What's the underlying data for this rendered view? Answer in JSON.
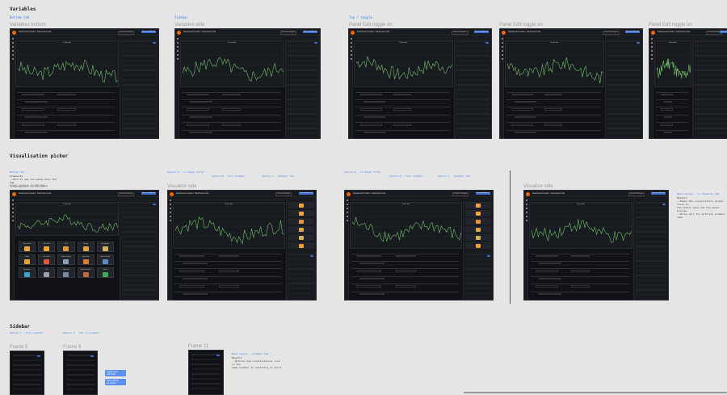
{
  "sections": {
    "variables": "Variables",
    "visualisation_picker": "Visualisation picker",
    "sidebar": "Sidebar"
  },
  "groups": {
    "bottom_tab": "Bottom tab",
    "sidebar": "Sidebar",
    "top_toggle": "Top / toggle"
  },
  "frames": {
    "variables_bottom": "Variables bottom",
    "variables_side": "Variables side",
    "panel_edit_toggle_1": "Panel Edit toggle on",
    "panel_edit_toggle_2": "Panel Edit toggle on",
    "panel_edit_toggle_3": "Panel Edit toggle on",
    "visualize_bottom": "Visualize bottom",
    "visualize_side_1": "Visualize side",
    "visualize_side_2": "Visualize side",
    "frame_5": "Frame 5",
    "frame_8": "Frame 8",
    "frame_11": "Frame 11"
  },
  "dashboard": {
    "breadcrumb": "Dashboard Folder / Dashboard title",
    "discard": "Discard changes",
    "save": "Save dashboard",
    "panel_title": "Panel title"
  },
  "notes": {
    "viz_note_title": "Bottom tab",
    "viz_note_body": "Drawbacks\n- Hard to see the panel when the tab\n  takes up most of the space",
    "option_a_title": "Option A - in Panel title",
    "option_b_title": "Option B - Full sidebar",
    "option_c_title": "Option C - Sidebar tab",
    "visualize_side_note_title": "Best option - in Property tab",
    "visualize_side_note_body": "Benefit\n- Keeps the visualization picker close to\n  the option pane and the panel preview\n- Works well for multiple sidebar tabs",
    "sidebar_note_1_title": "Option 1 - Full sidebar",
    "sidebar_note_2_title": "Option 2 - Tab in sidebar",
    "sidebar_note_3_title": "Best option - Sidebar tab",
    "sidebar_note_3_body": "Benefit\n- Options and visualizations live in the\n  same sidebar so switching is quick",
    "blue_1": "Toggle panel\nedit mode",
    "blue_2": "Open sidebar\nfor options"
  },
  "viz_types": [
    {
      "label": "Time series",
      "color": "#f2a43a"
    },
    {
      "label": "Bar chart",
      "color": "#f2a43a"
    },
    {
      "label": "Stat",
      "color": "#e8943a"
    },
    {
      "label": "Gauge",
      "color": "#e0a542"
    },
    {
      "label": "Bar gauge",
      "color": "#d6b35a"
    },
    {
      "label": "Table",
      "color": "#f0a030"
    },
    {
      "label": "Pie chart",
      "color": "#e05a3a"
    },
    {
      "label": "State timeline",
      "color": "#8aa0b5"
    },
    {
      "label": "Heatmap",
      "color": "#e07c30"
    },
    {
      "label": "Status history",
      "color": "#5a8ac7"
    },
    {
      "label": "Histogram",
      "color": "#3aa0d0"
    },
    {
      "label": "Text",
      "color": "#9aa0a8"
    },
    {
      "label": "Alert list",
      "color": "#7a8ca0"
    },
    {
      "label": "Dashboard list",
      "color": "#c06a3a"
    },
    {
      "label": "News",
      "color": "#3eaf4c"
    }
  ]
}
